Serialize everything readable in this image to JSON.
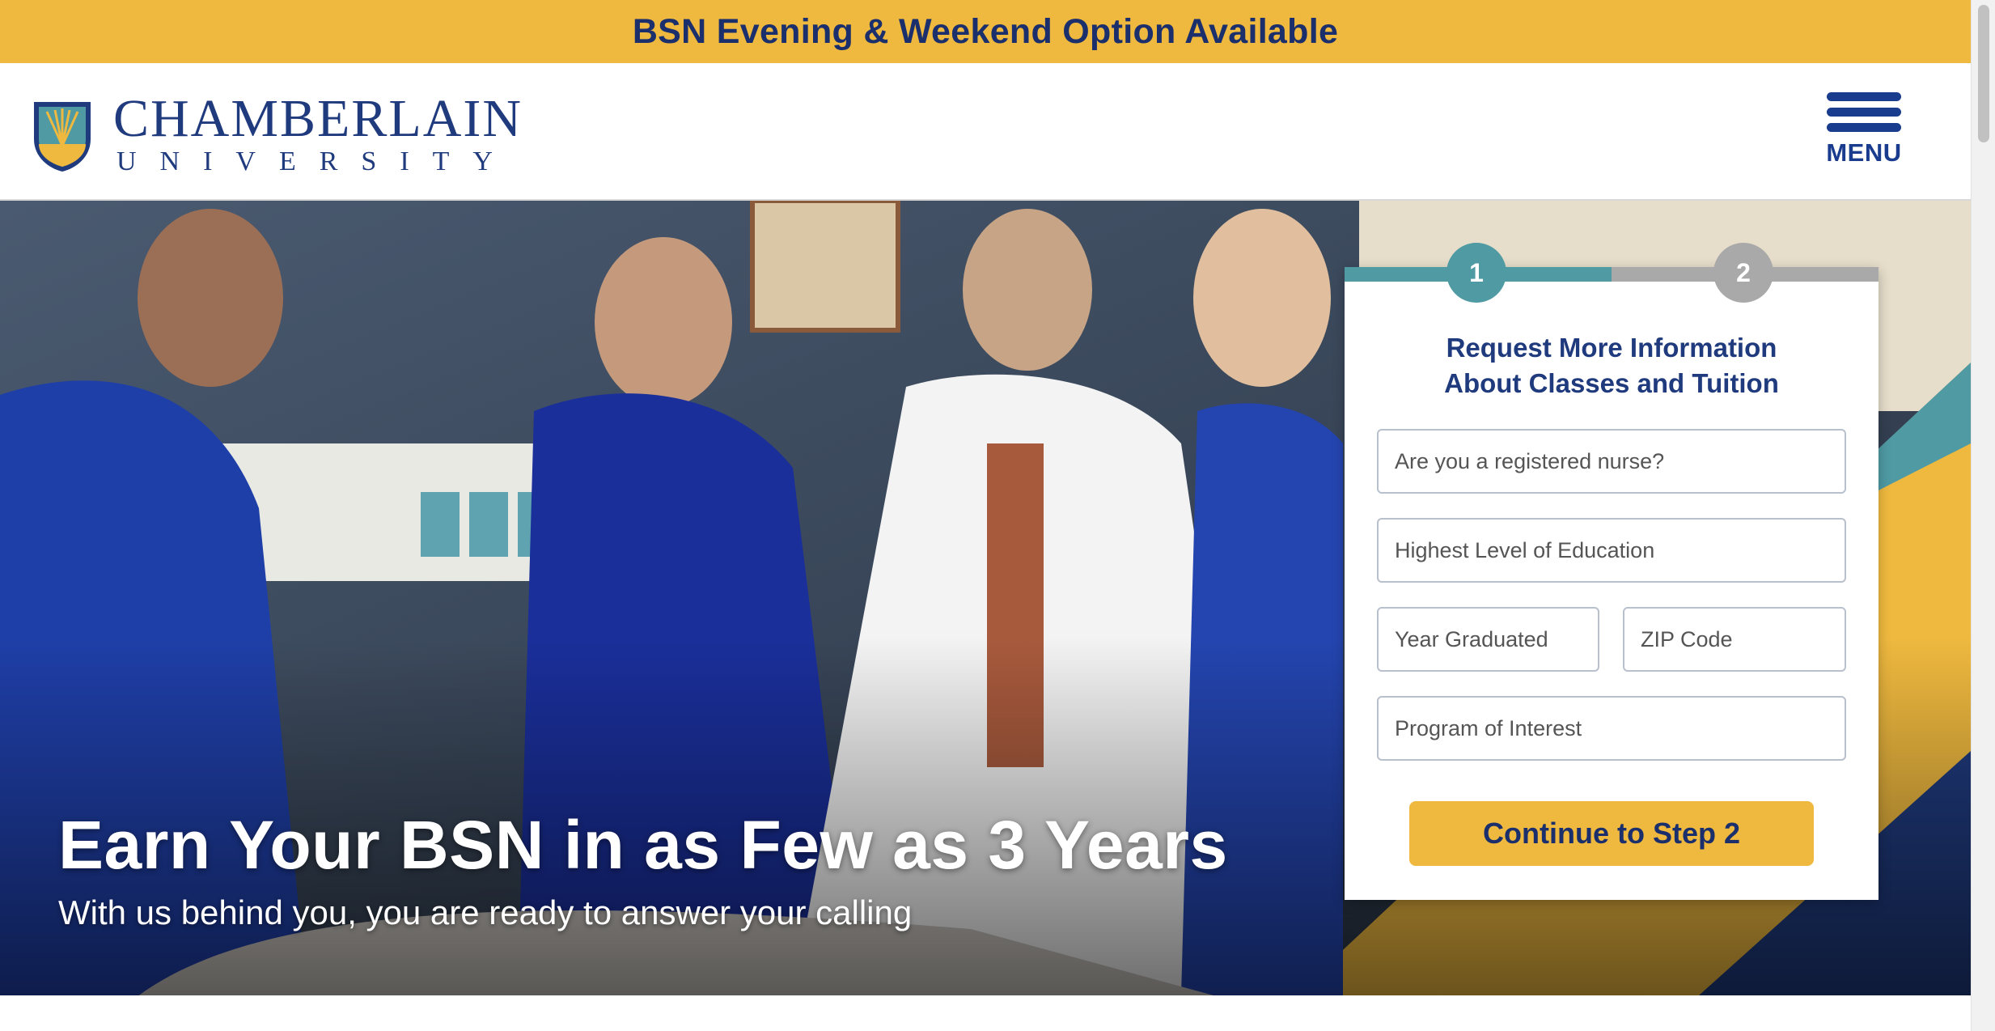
{
  "announcement": {
    "text": "BSN Evening & Weekend Option Available"
  },
  "header": {
    "logo_top": "CHAMBERLAIN",
    "logo_bottom": "UNIVERSITY",
    "menu_label": "MENU"
  },
  "hero": {
    "headline": "Earn Your BSN in as Few as 3 Years",
    "subheadline": "With us behind you, you are ready to answer your calling"
  },
  "form": {
    "step1": "1",
    "step2": "2",
    "title_line1": "Request More Information",
    "title_line2": "About Classes and Tuition",
    "fields": {
      "registered_nurse": "Are you a registered nurse?",
      "education": "Highest Level of Education",
      "year_graduated": "Year Graduated",
      "zip": "ZIP Code",
      "program": "Program of Interest"
    },
    "submit_label": "Continue to Step 2"
  },
  "colors": {
    "accent_gold": "#efb93f",
    "navy": "#1f3a7d",
    "teal": "#4f9aa3"
  }
}
